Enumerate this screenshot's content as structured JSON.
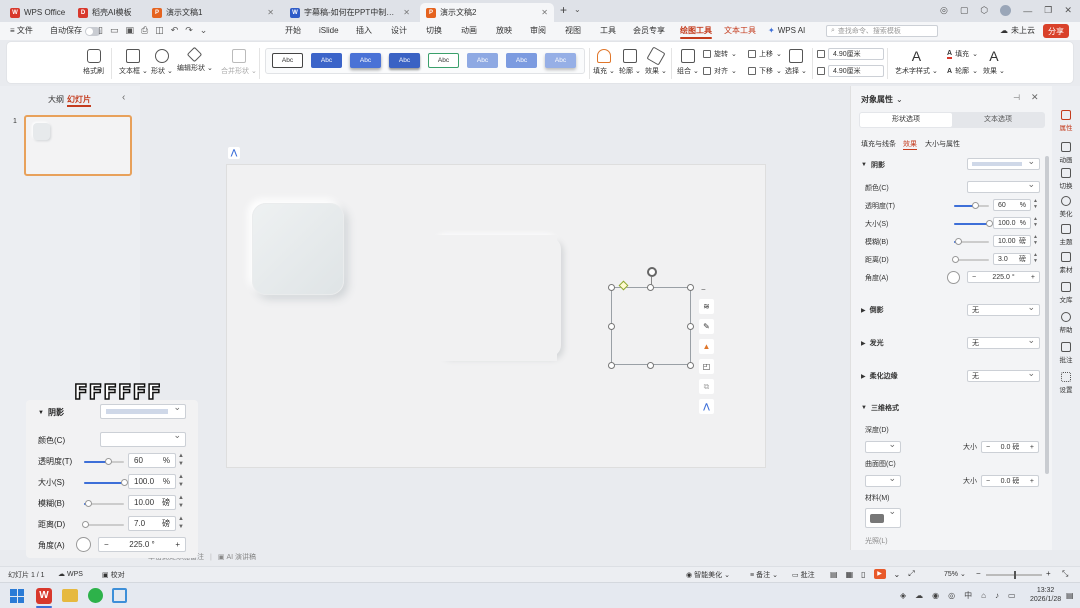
{
  "titlebar": {
    "tabs": [
      {
        "label": "WPS Office",
        "color": "#d8382c"
      },
      {
        "label": "稻壳AI模板",
        "color": "#d8382c"
      },
      {
        "label": "演示文稿1",
        "color": "#e5631f"
      },
      {
        "label": "字幕稿-如何在PPT中制作新拟态...",
        "color": "#2f5cc8"
      },
      {
        "label": "演示文稿2",
        "color": "#e5631f"
      }
    ],
    "new_tab": "+"
  },
  "menubar": {
    "file": "文件",
    "autosave": "自动保存",
    "items": [
      "开始",
      "iSlide",
      "插入",
      "设计",
      "切换",
      "动画",
      "放映",
      "审阅",
      "视图",
      "工具",
      "会员专享",
      "绘图工具",
      "文本工具",
      "WPS AI"
    ],
    "active": "绘图工具",
    "search_placeholder": "查找命令、搜索模板",
    "cloud": "未上云",
    "share": "分享"
  },
  "ribbon": {
    "format_painter": "格式刷",
    "textbox": "文本框",
    "shape": "形状",
    "edit_shape": "编辑形状",
    "merge_shape": "合并形状",
    "style_label": "Abc",
    "fill": "填充",
    "outline": "轮廓",
    "effect": "效果",
    "group": "组合",
    "align": "对齐",
    "rotate": "旋转",
    "select": "选择",
    "up": "上移",
    "down": "下移",
    "height": "4.90厘米",
    "width": "4.90厘米",
    "art_text": "艺术字样式",
    "text_fill": "填充",
    "text_outline": "轮廓",
    "text_effect": "效果"
  },
  "leftpane": {
    "tab_outline": "大纲",
    "tab_slides": "幻灯片",
    "slide_number": "1"
  },
  "rightpane": {
    "title": "对象属性",
    "tab_shape": "形状选项",
    "tab_text": "文本选项",
    "sub_fill": "填充与线条",
    "sub_effect": "效果",
    "sub_size": "大小与属性",
    "shadow": "阴影",
    "color": "颜色(C)",
    "transparency": "透明度(T)",
    "transparency_val": "60",
    "percent": "%",
    "size": "大小(S)",
    "size_val": "100.0",
    "blur": "模糊(B)",
    "blur_val": "10.00",
    "pound": "磅",
    "distance": "距离(D)",
    "distance_val": "3.0",
    "angle": "角度(A)",
    "angle_val": "225.0",
    "degree": "°",
    "reflection": "倒影",
    "glow": "发光",
    "soft_edge": "柔化边缘",
    "none": "无",
    "threed": "三维格式",
    "depth": "深度(D)",
    "contour": "曲面图(C)",
    "size_label": "大小",
    "zero": "0.0",
    "material": "材料(M)",
    "lighting": "光照(L)",
    "transparency_pct": 0.6,
    "size_pct": 1.0,
    "blur_pct": 0.1,
    "distance_pct": 0.03
  },
  "sidebar": [
    "属性",
    "动画",
    "切换",
    "美化",
    "主题",
    "素材",
    "文库",
    "帮助",
    "批注",
    "设置"
  ],
  "zoom_overlay": {
    "label": "FFFFFF",
    "shadow": "阴影",
    "color": "颜色(C)",
    "transparency": "透明度(T)",
    "transparency_val": "60",
    "percent": "%",
    "size": "大小(S)",
    "size_val": "100.0",
    "blur": "模糊(B)",
    "blur_val": "10.00",
    "pound": "磅",
    "distance": "距离(D)",
    "distance_val": "7.0",
    "angle": "角度(A)",
    "angle_val": "225.0",
    "degree": "°"
  },
  "notes": {
    "add_note": "单击此处添加备注",
    "ai_speech": "AI 演讲稿"
  },
  "status": {
    "slide": "幻灯片 1 / 1",
    "wps": "WPS",
    "proof": "校对",
    "smart": "智能美化",
    "notes": "备注",
    "comment": "批注",
    "zoom": "75%"
  },
  "taskbar": {
    "time": "13:32",
    "date": "2026/1/28",
    "ime": "中"
  }
}
